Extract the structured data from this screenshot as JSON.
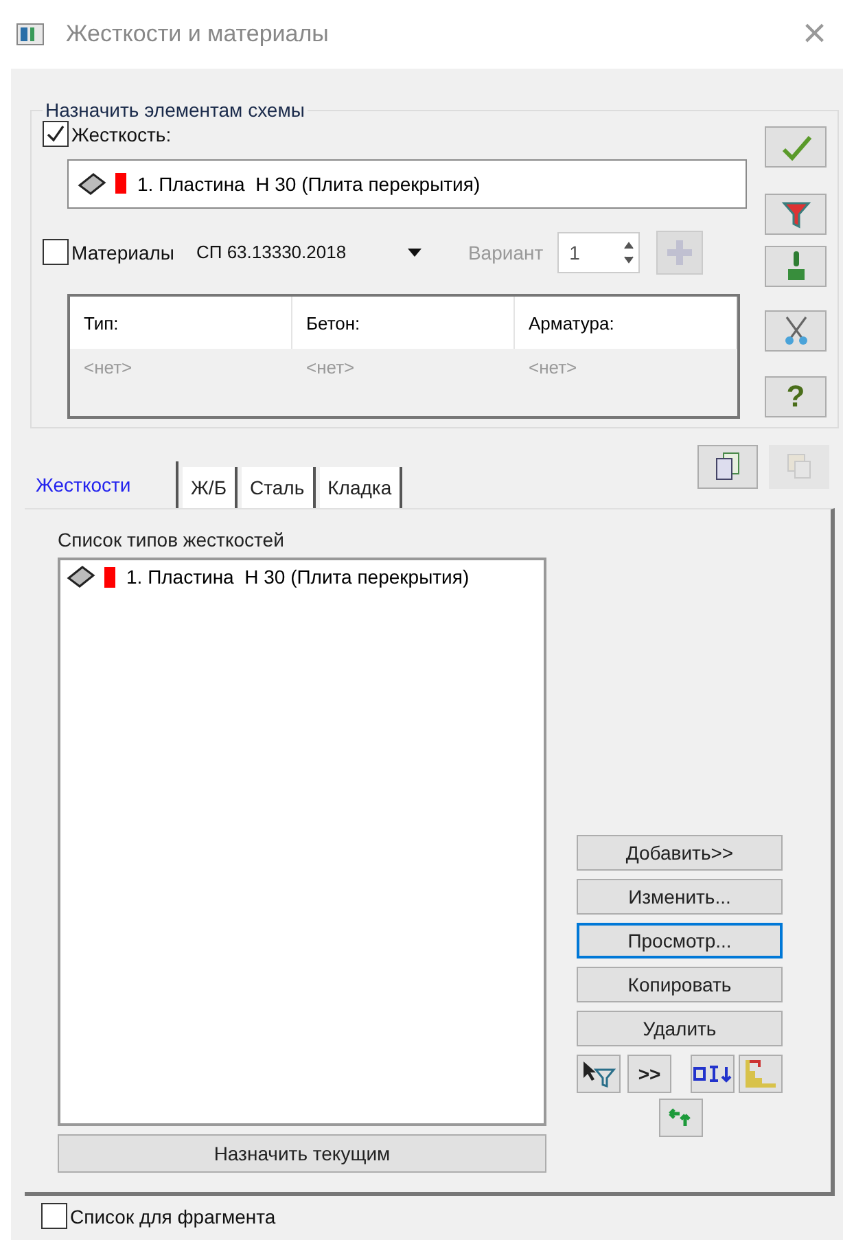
{
  "window": {
    "title": "Жесткости и материалы",
    "close": "×"
  },
  "assign_group": {
    "title": "Назначить элементам схемы",
    "stiffness": {
      "label": "Жесткость:",
      "checked": true,
      "value": "1. Пластина  Н 30 (Плита перекрытия)"
    },
    "materials": {
      "label": "Материалы",
      "checked": false,
      "norm": "СП 63.13330.2018",
      "variant": {
        "label": "Вариант",
        "value": "1",
        "disabled": true
      },
      "add_disabled": true
    },
    "table": {
      "columns": [
        "Тип:",
        "Бетон:",
        "Арматура:"
      ],
      "rows": [
        [
          "<нет>",
          "<нет>",
          "<нет>"
        ]
      ]
    }
  },
  "side_tools": [
    {
      "kind": "apply"
    },
    {
      "kind": "filter"
    },
    {
      "kind": "brush"
    },
    {
      "kind": "scissors"
    },
    {
      "kind": "help",
      "label": "?"
    }
  ],
  "copy_tools": [
    {
      "kind": "copy",
      "disabled": false
    },
    {
      "kind": "paste",
      "disabled": true
    }
  ],
  "tabs": [
    {
      "label": "Жесткости",
      "selected": true
    },
    {
      "label": "Ж/Б",
      "selected": false
    },
    {
      "label": "Сталь",
      "selected": false
    },
    {
      "label": "Кладка",
      "selected": false
    }
  ],
  "stiffness_list": {
    "title": "Список типов жесткостей",
    "items": [
      {
        "label": "1. Пластина  Н 30 (Плита перекрытия)"
      }
    ]
  },
  "actions": [
    {
      "label": "Добавить>>",
      "focused": false
    },
    {
      "label": "Изменить...",
      "focused": false
    },
    {
      "label": "Просмотр...",
      "focused": true
    },
    {
      "label": "Копировать",
      "focused": false
    },
    {
      "label": "Удалить",
      "focused": false
    }
  ],
  "small_tools": [
    {
      "kind": "select-filter"
    },
    {
      "kind": "more",
      "label": ">>"
    },
    {
      "kind": "spread"
    },
    {
      "kind": "stairs"
    },
    {
      "kind": "swap"
    }
  ],
  "assign_button": "Назначить текущим",
  "fragment_list": {
    "label": "Список для фрагмента",
    "checked": false
  }
}
